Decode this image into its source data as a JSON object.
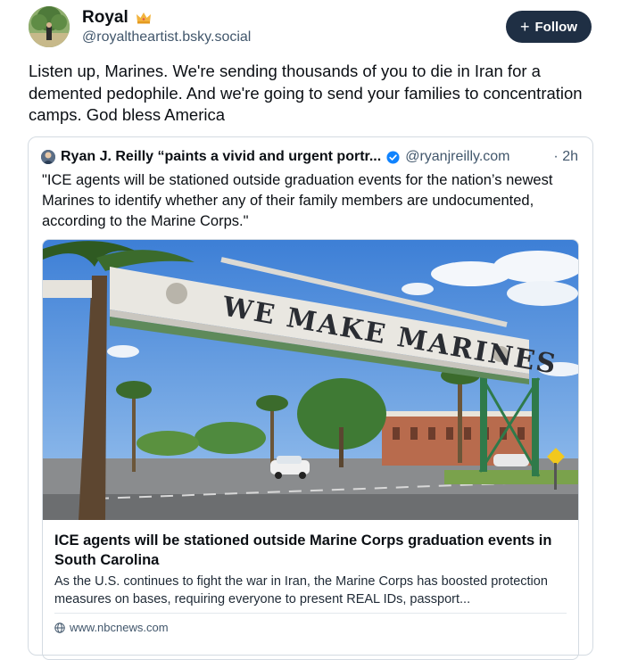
{
  "author": {
    "display_name": "Royal",
    "handle": "@royaltheartist.bsky.social",
    "badge_icon": "crown-icon"
  },
  "follow_button": {
    "label": "Follow",
    "icon": "plus-icon"
  },
  "post": {
    "text": "Listen up, Marines. We're sending thousands of you to die in Iran for a demented pedophile. And we're going to send your families to concentration camps. God bless America"
  },
  "quote": {
    "author_name": "Ryan J. Reilly “paints a vivid and urgent portr...",
    "handle": "@ryanjreilly.com",
    "time": "· 2h",
    "text": "\"ICE agents will be stationed outside graduation events for the nation’s newest Marines to identify whether any of their family members are undocumented, according to the Marine Corps.\"",
    "card": {
      "image_sign_text": "WE MAKE MARINES",
      "title": "ICE agents will be stationed outside Marine Corps graduation events in South Carolina",
      "description": "As the U.S. continues to fight the war in Iran, the Marine Corps has boosted protection measures on bases, requiring everyone to present REAL IDs, passport...",
      "domain": "www.nbcnews.com"
    }
  },
  "colors": {
    "follow_bg": "#1f2f44",
    "verified_blue": "#1083fe",
    "muted_text": "#42576c",
    "border": "#d4dbe2"
  }
}
